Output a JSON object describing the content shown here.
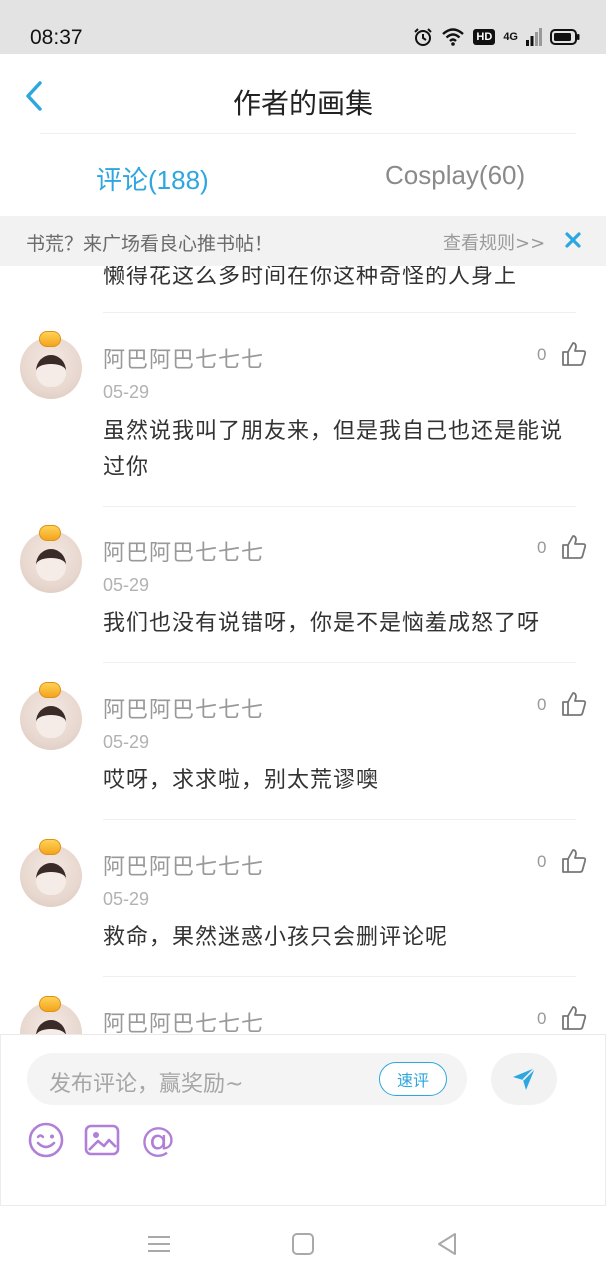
{
  "status_bar": {
    "time": "08:37",
    "hd_label": "HD",
    "network_label": "4G",
    "icons": [
      "alarm-icon",
      "wifi-icon",
      "hd-icon",
      "signal-icon",
      "battery-icon"
    ]
  },
  "header": {
    "title": "作者的画集",
    "back_icon": "chevron-left-icon"
  },
  "tabs": [
    {
      "label": "评论(188)",
      "active": true
    },
    {
      "label": "Cosplay(60)",
      "active": false
    }
  ],
  "notice": {
    "text": "书荒？来广场看良心推书帖！",
    "link": "查看规则>>",
    "close_icon": "close-icon"
  },
  "comments": {
    "partial_text": "懒得花这么多时间在你这种奇怪的人身上",
    "items": [
      {
        "username": "阿巴阿巴七七七",
        "date": "05-29",
        "likes": "0",
        "text": "虽然说我叫了朋友来，但是我自己也还是能说过你"
      },
      {
        "username": "阿巴阿巴七七七",
        "date": "05-29",
        "likes": "0",
        "text": "我们也没有说错呀，你是不是恼羞成怒了呀"
      },
      {
        "username": "阿巴阿巴七七七",
        "date": "05-29",
        "likes": "0",
        "text": "哎呀，求求啦，别太荒谬噢"
      },
      {
        "username": "阿巴阿巴七七七",
        "date": "05-29",
        "likes": "0",
        "text": "救命，果然迷惑小孩只会删评论呢"
      },
      {
        "username": "阿巴阿巴七七七",
        "likes": "0"
      }
    ]
  },
  "composer": {
    "placeholder": "发布评论，赢奖励~",
    "quick_review_label": "速评",
    "send_icon": "send-icon",
    "tools": [
      "emoji-icon",
      "image-icon",
      "mention-icon"
    ],
    "mention_symbol": "@"
  },
  "nav_bar": {
    "icons": [
      "menu-icon",
      "home-icon",
      "back-triangle-icon"
    ]
  },
  "colors": {
    "accent": "#2ea6df",
    "tool_purple": "#b07fd8",
    "badge_gold": "#f3a41e"
  }
}
